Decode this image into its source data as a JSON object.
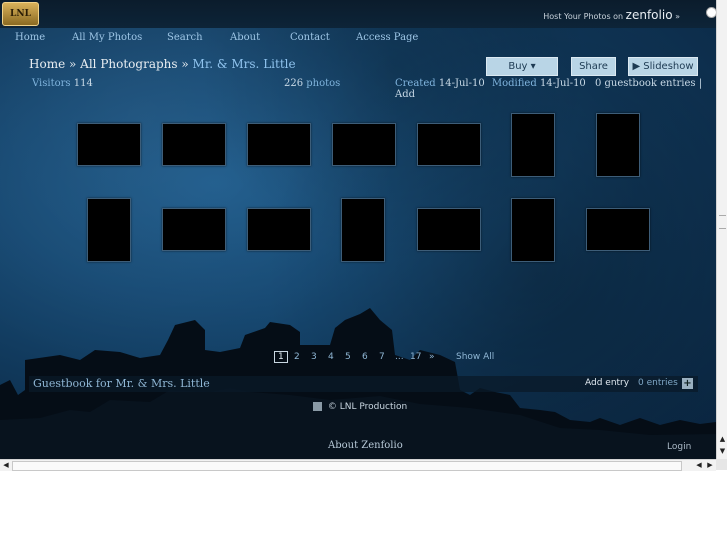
{
  "logo": {
    "text": "LNL"
  },
  "host": {
    "prefix": "Host Your Photos on",
    "brand": "zenfolio",
    "suffix": "»"
  },
  "nav": [
    "Home",
    "All My Photos",
    "Search",
    "About",
    "Contact",
    "Access Page"
  ],
  "breadcrumb": {
    "home": "Home",
    "sep": "»",
    "all": "All Photographs",
    "sep2": "»",
    "current": "Mr. & Mrs. Little"
  },
  "buttons": {
    "buy": "Buy ▾",
    "share": "Share",
    "slideshow": "▶ Slideshow"
  },
  "meta": {
    "visitors_label": "Visitors",
    "visitors_value": "114",
    "photos_value": "226",
    "photos_label": "photos",
    "created_label": "Created",
    "created_value": "14-Jul-10",
    "modified_label": "Modified",
    "modified_value": "14-Jul-10",
    "guestbook": "0 guestbook entries",
    "add": "| Add"
  },
  "pager": {
    "pages": [
      "1",
      "2",
      "3",
      "4",
      "5",
      "6",
      "7",
      "...",
      "17",
      "»"
    ],
    "current": "1",
    "show_all": "Show All"
  },
  "guestbook": {
    "title": "Guestbook for Mr. & Mrs. Little",
    "add_entry": "Add entry",
    "entries": "0 entries",
    "plus": "+"
  },
  "footer": {
    "copyright": "© LNL Production",
    "about": "About Zenfolio",
    "login": "Login"
  },
  "colors": {
    "accent": "#8fc3ee",
    "background": "#174a74",
    "button": "#b9d5e6"
  }
}
